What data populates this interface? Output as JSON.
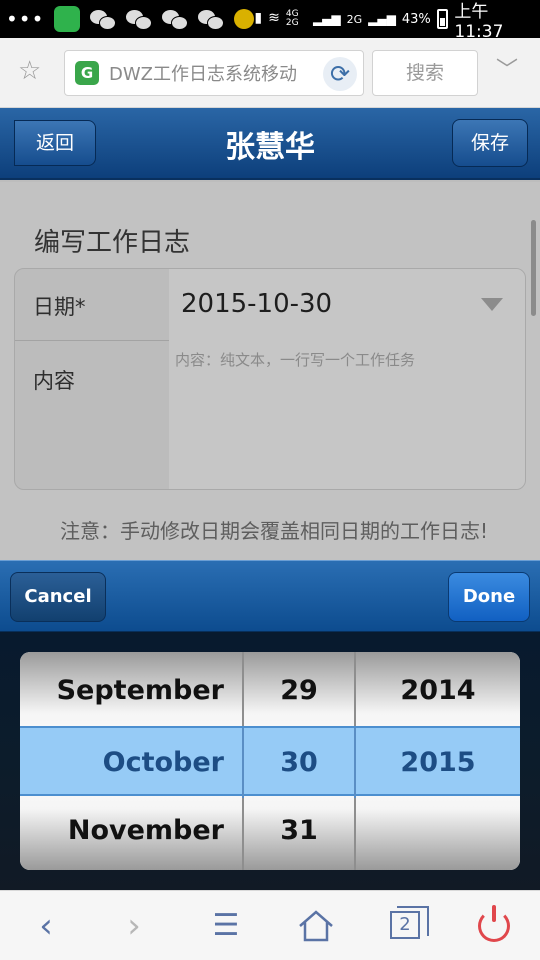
{
  "status_bar": {
    "signal_text": "4G 2G",
    "sim2_text": "2G",
    "battery": "43%",
    "time": "上午11:37"
  },
  "browser": {
    "url_text": "DWZ工作日志系统移动",
    "search_label": "搜索"
  },
  "page": {
    "header": {
      "back_label": "返回",
      "title": "张慧华",
      "save_label": "保存"
    },
    "form_title": "编写工作日志",
    "date_label": "日期*",
    "date_value": "2015-10-30",
    "content_label": "内容",
    "content_placeholder": "内容：纯文本，一行写一个工作任务",
    "note": "注意：手动修改日期会覆盖相同日期的工作日志!"
  },
  "picker": {
    "cancel_label": "Cancel",
    "done_label": "Done",
    "months": [
      "September",
      "October",
      "November"
    ],
    "days": [
      "29",
      "30",
      "31"
    ],
    "years": [
      "2014",
      "2015",
      ""
    ],
    "selected": {
      "month": "October",
      "day": "30",
      "year": "2015"
    }
  },
  "bottom_nav": {
    "tabs_count": "2",
    "icons": [
      "back-icon",
      "forward-icon",
      "menu-icon",
      "home-icon",
      "tabs-icon",
      "power-icon"
    ]
  }
}
